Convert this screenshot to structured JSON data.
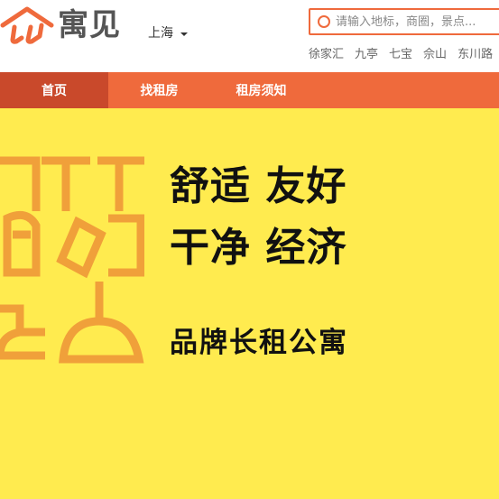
{
  "brand": {
    "name": "寓见",
    "accent": "#ef6a3c",
    "accent_dark": "#c9492b"
  },
  "header": {
    "city": "上海",
    "search": {
      "placeholder": "请输入地标，商圈，景点..."
    },
    "hot_places": [
      "徐家汇",
      "九亭",
      "七宝",
      "佘山",
      "东川路"
    ]
  },
  "nav": {
    "items": [
      {
        "label": "首页",
        "active": true
      },
      {
        "label": "找租房",
        "active": false
      },
      {
        "label": "租房须知",
        "active": false
      }
    ]
  },
  "banner": {
    "background": "#ffeb4f",
    "art_color": "#f0a03a",
    "line1": "舒适 友好",
    "line2": "干净 经济",
    "line3": "品牌长租公寓"
  }
}
